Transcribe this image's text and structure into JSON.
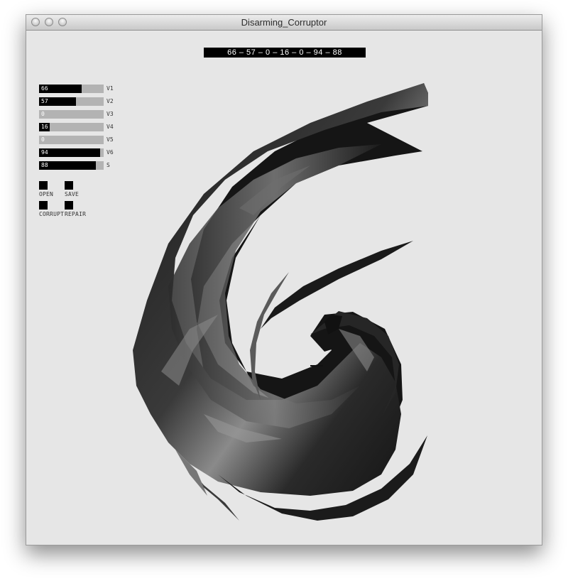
{
  "window": {
    "title": "Disarming_Corruptor"
  },
  "readout": {
    "text": "66 – 57 – 0 – 16 – 0 – 94 – 88"
  },
  "sliders": [
    {
      "label": "V1",
      "value": "66",
      "fraction": 0.66
    },
    {
      "label": "V2",
      "value": "57",
      "fraction": 0.57
    },
    {
      "label": "V3",
      "value": "0",
      "fraction": 0.0
    },
    {
      "label": "V4",
      "value": "16",
      "fraction": 0.16
    },
    {
      "label": "V5",
      "value": "0",
      "fraction": 0.0
    },
    {
      "label": "V6",
      "value": "94",
      "fraction": 0.94
    },
    {
      "label": "S",
      "value": "88",
      "fraction": 0.88
    }
  ],
  "buttons": {
    "open": "OPEN",
    "save": "SAVE",
    "corrupt": "CORRUPT",
    "repair": "REPAIR"
  },
  "colors": {
    "background": "#e6e6e6",
    "slider_fill": "#000000",
    "slider_track": "#b3b3b3",
    "shape_dark": "#141414",
    "shape_light": "#9a9a9a"
  }
}
